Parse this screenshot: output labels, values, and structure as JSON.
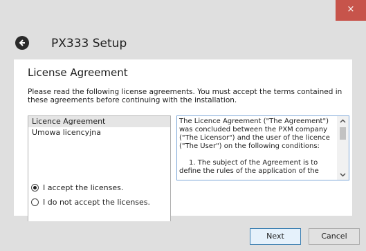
{
  "window": {
    "title": "PX333 Setup",
    "close_glyph": "×"
  },
  "page": {
    "heading": "License Agreement",
    "instructions": "Please read the following license agreements. You must accept the terms contained in these agreements before continuing with the installation."
  },
  "licenses": [
    {
      "label": "Licence Agreement",
      "selected": true
    },
    {
      "label": "Umowa licencyjna",
      "selected": false
    }
  ],
  "license_text": {
    "paragraph1": "The Licence Agreement (\"The Agreement\") was concluded between the PXM company (\"The Licensor\") and the user of the licence (\"The User\") on the following conditions:",
    "paragraph2": "1. The subject of the Agreement is to define the rules of the application of the"
  },
  "options": {
    "accept": "I accept the licenses.",
    "decline": "I do not accept the licenses.",
    "selected": "accept"
  },
  "buttons": {
    "next": "Next",
    "cancel": "Cancel"
  },
  "colors": {
    "close_button": "#c7544b",
    "primary_border": "#3c7fb1"
  },
  "icons": {
    "back": "back-arrow-icon",
    "close": "close-icon",
    "scroll_up": "chevron-up-icon",
    "scroll_down": "chevron-down-icon"
  }
}
